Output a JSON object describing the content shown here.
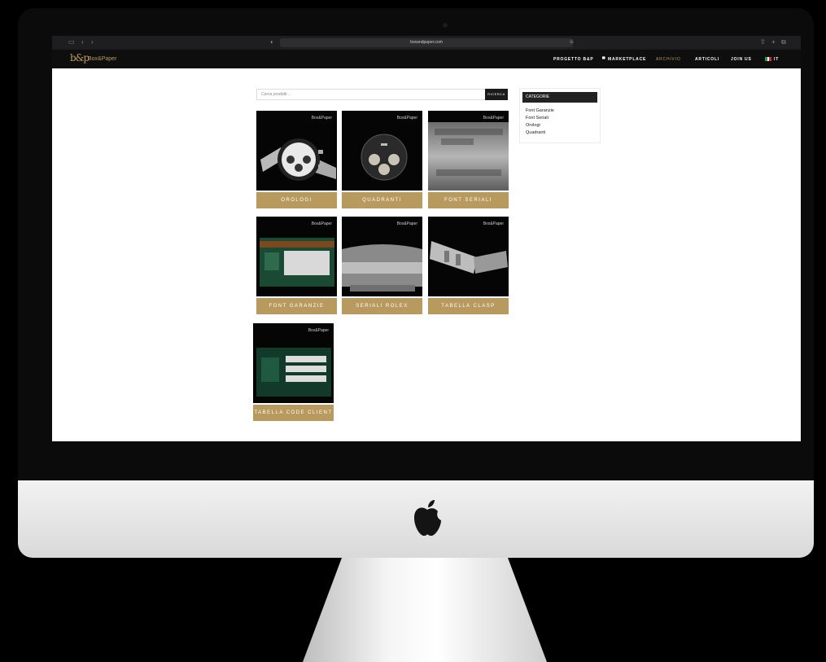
{
  "browser": {
    "url": "boxandpaper.com"
  },
  "brand": {
    "logo": "b&p",
    "name": "Box&Paper",
    "accent": "#b89a5f"
  },
  "nav": {
    "items": [
      {
        "label": "PROGETTO B&P"
      },
      {
        "label": "MARKETPLACE"
      },
      {
        "label": "ARCHIVIO"
      },
      {
        "label": "ARTICOLI"
      },
      {
        "label": "JOIN US"
      },
      {
        "label": "IT"
      }
    ]
  },
  "search": {
    "placeholder": "Cerca prodotti…",
    "button": "RICERCA"
  },
  "categories": [
    {
      "label": "OROLOGI",
      "brand": "Box&Paper"
    },
    {
      "label": "QUADRANTI",
      "brand": "Box&Paper"
    },
    {
      "label": "FONT SERIALI",
      "brand": "Box&Paper"
    },
    {
      "label": "FONT GARANZIE",
      "brand": "Box&Paper"
    },
    {
      "label": "SERIALI ROLEX",
      "brand": "Box&Paper"
    },
    {
      "label": "TABELLA CLASP",
      "brand": "Box&Paper"
    },
    {
      "label": "TABELLA CODE CLIENT",
      "brand": "Box&Paper"
    }
  ],
  "sidebar": {
    "title": "CATEGORIE",
    "links": [
      "Font Garanzie",
      "Font Seriali",
      "Orologi",
      "Quadranti"
    ]
  }
}
